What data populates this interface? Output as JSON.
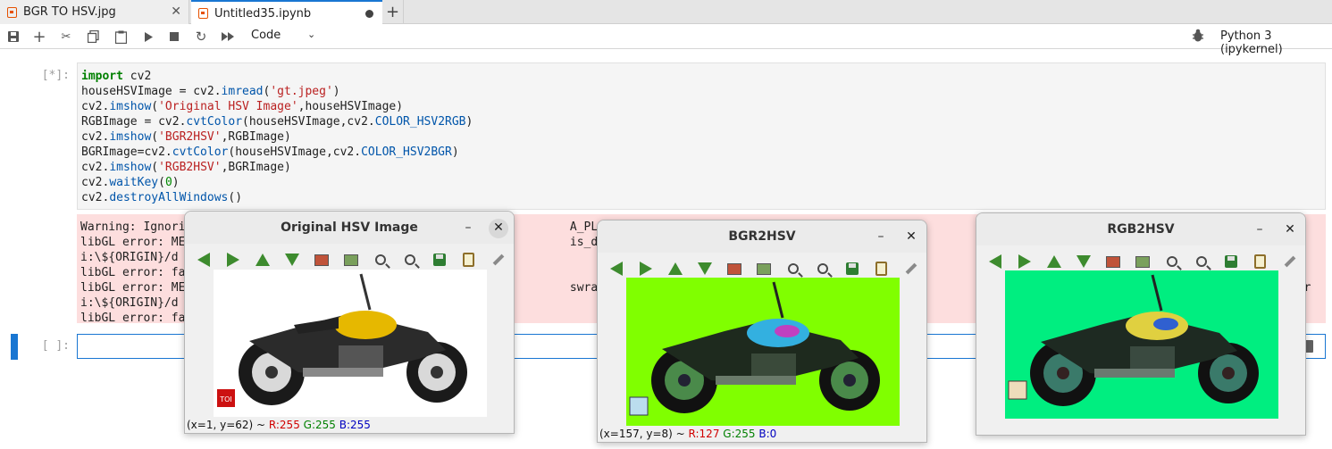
{
  "tabs": [
    {
      "label": "BGR TO HSV.jpg",
      "active": false
    },
    {
      "label": "Untitled35.ipynb",
      "active": true
    }
  ],
  "toolbar": {
    "cell_type": "Code",
    "kernel": "Python 3 (ipykernel)"
  },
  "cells": {
    "code_prompt": "[*]:",
    "code_lines": [
      [
        [
          "kw",
          "import"
        ],
        [
          "",
          " cv2"
        ]
      ],
      [
        [
          "",
          "houseHSVImage = cv2."
        ],
        [
          "attr",
          "imread"
        ],
        [
          "",
          "("
        ],
        [
          "str",
          "'gt.jpeg'"
        ],
        [
          "",
          ")"
        ]
      ],
      [
        [
          "",
          "cv2."
        ],
        [
          "attr",
          "imshow"
        ],
        [
          "",
          "("
        ],
        [
          "str",
          "'Original HSV Image'"
        ],
        [
          "",
          ",houseHSVImage)"
        ]
      ],
      [
        [
          "",
          "RGBImage = cv2."
        ],
        [
          "attr",
          "cvtColor"
        ],
        [
          "",
          "(houseHSVImage,cv2."
        ],
        [
          "attr",
          "COLOR_HSV2RGB"
        ],
        [
          "",
          ")"
        ]
      ],
      [
        [
          "",
          "cv2."
        ],
        [
          "attr",
          "imshow"
        ],
        [
          "",
          "("
        ],
        [
          "str",
          "'BGR2HSV'"
        ],
        [
          "",
          ",RGBImage)"
        ]
      ],
      [
        [
          "",
          "BGRImage=cv2."
        ],
        [
          "attr",
          "cvtColor"
        ],
        [
          "",
          "(houseHSVImage,cv2."
        ],
        [
          "attr",
          "COLOR_HSV2BGR"
        ],
        [
          "",
          ")"
        ]
      ],
      [
        [
          "",
          "cv2."
        ],
        [
          "attr",
          "imshow"
        ],
        [
          "",
          "("
        ],
        [
          "str",
          "'RGB2HSV'"
        ],
        [
          "",
          ",BGRImage)"
        ]
      ],
      [
        [
          "",
          "cv2."
        ],
        [
          "attr",
          "waitKey"
        ],
        [
          "",
          "("
        ],
        [
          "num",
          "0"
        ],
        [
          "",
          ")"
        ]
      ],
      [
        [
          "",
          "cv2."
        ],
        [
          "attr",
          "destroyAllWindows"
        ],
        [
          "",
          "()"
        ]
      ]
    ],
    "error_lines": [
      "Warning: Ignori                                                       A_PLATFORM=w                                                                 ",
      "libGL error: ME                                                       is_dri.so: c                                                            directo",
      "i:\\${ORIGIN}/d",
      "libGL error: fa",
      "libGL error: ME                                                       swrast_dri.s                                                            or dir                          dr",
      "i:\\${ORIGIN}/d",
      "libGL error: fa"
    ],
    "empty_prompt": "[ ]:"
  },
  "windows": [
    {
      "title": "Original HSV Image",
      "status_pos": "(x=1, y=62) ~ ",
      "r": "R:255",
      "g": "G:255",
      "b": "B:255",
      "bg": "#ffffff"
    },
    {
      "title": "BGR2HSV",
      "status_pos": "(x=157, y=8) ~ ",
      "r": "R:127",
      "g": "G:255",
      "b": "B:0",
      "bg": "#80ff00"
    },
    {
      "title": "RGB2HSV",
      "status_pos": "",
      "r": "",
      "g": "",
      "b": "",
      "bg": "#00ee80"
    }
  ]
}
